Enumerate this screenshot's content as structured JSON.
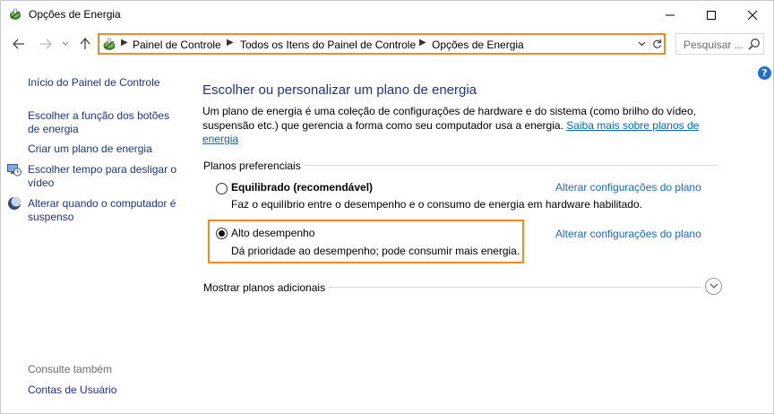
{
  "window": {
    "title": "Opções de Energia"
  },
  "address_bar": {
    "crumbs": [
      "Painel de Controle",
      "Todos os Itens do Painel de Controle",
      "Opções de Energia"
    ]
  },
  "search": {
    "placeholder": "Pesquisar ..."
  },
  "sidebar": {
    "home": "Início do Painel de Controle",
    "links": [
      "Escolher a função dos botões de energia",
      "Criar um plano de energia",
      "Escolher tempo para desligar o vídeo",
      "Alterar quando o computador é suspenso"
    ],
    "see_also_label": "Consulte também",
    "see_also_links": [
      "Contas de Usuário"
    ]
  },
  "help_glyph": "?",
  "main": {
    "title": "Escolher ou personalizar um plano de energia",
    "description": "Um plano de energia é uma coleção de configurações de hardware e do sistema (como brilho do vídeo, suspensão etc.) que gerencia a forma como seu computador usa a energia.",
    "learn_more": "Saiba mais sobre planos de energia",
    "plans_group_label": "Planos preferenciais",
    "plans": [
      {
        "name": "Equilibrado (recomendável)",
        "description": "Faz o equilíbrio entre o desempenho e o consumo de energia em hardware habilitado.",
        "link": "Alterar configurações do plano",
        "selected": false
      },
      {
        "name": "Alto desempenho",
        "description": "Dá prioridade ao desempenho; pode consumir mais energia.",
        "link": "Alterar configurações do plano",
        "selected": true
      }
    ],
    "more_plans_label": "Mostrar planos adicionais"
  },
  "colors": {
    "link": "#1e3287",
    "highlight": "#f08a24",
    "help": "#1f6fd6"
  }
}
